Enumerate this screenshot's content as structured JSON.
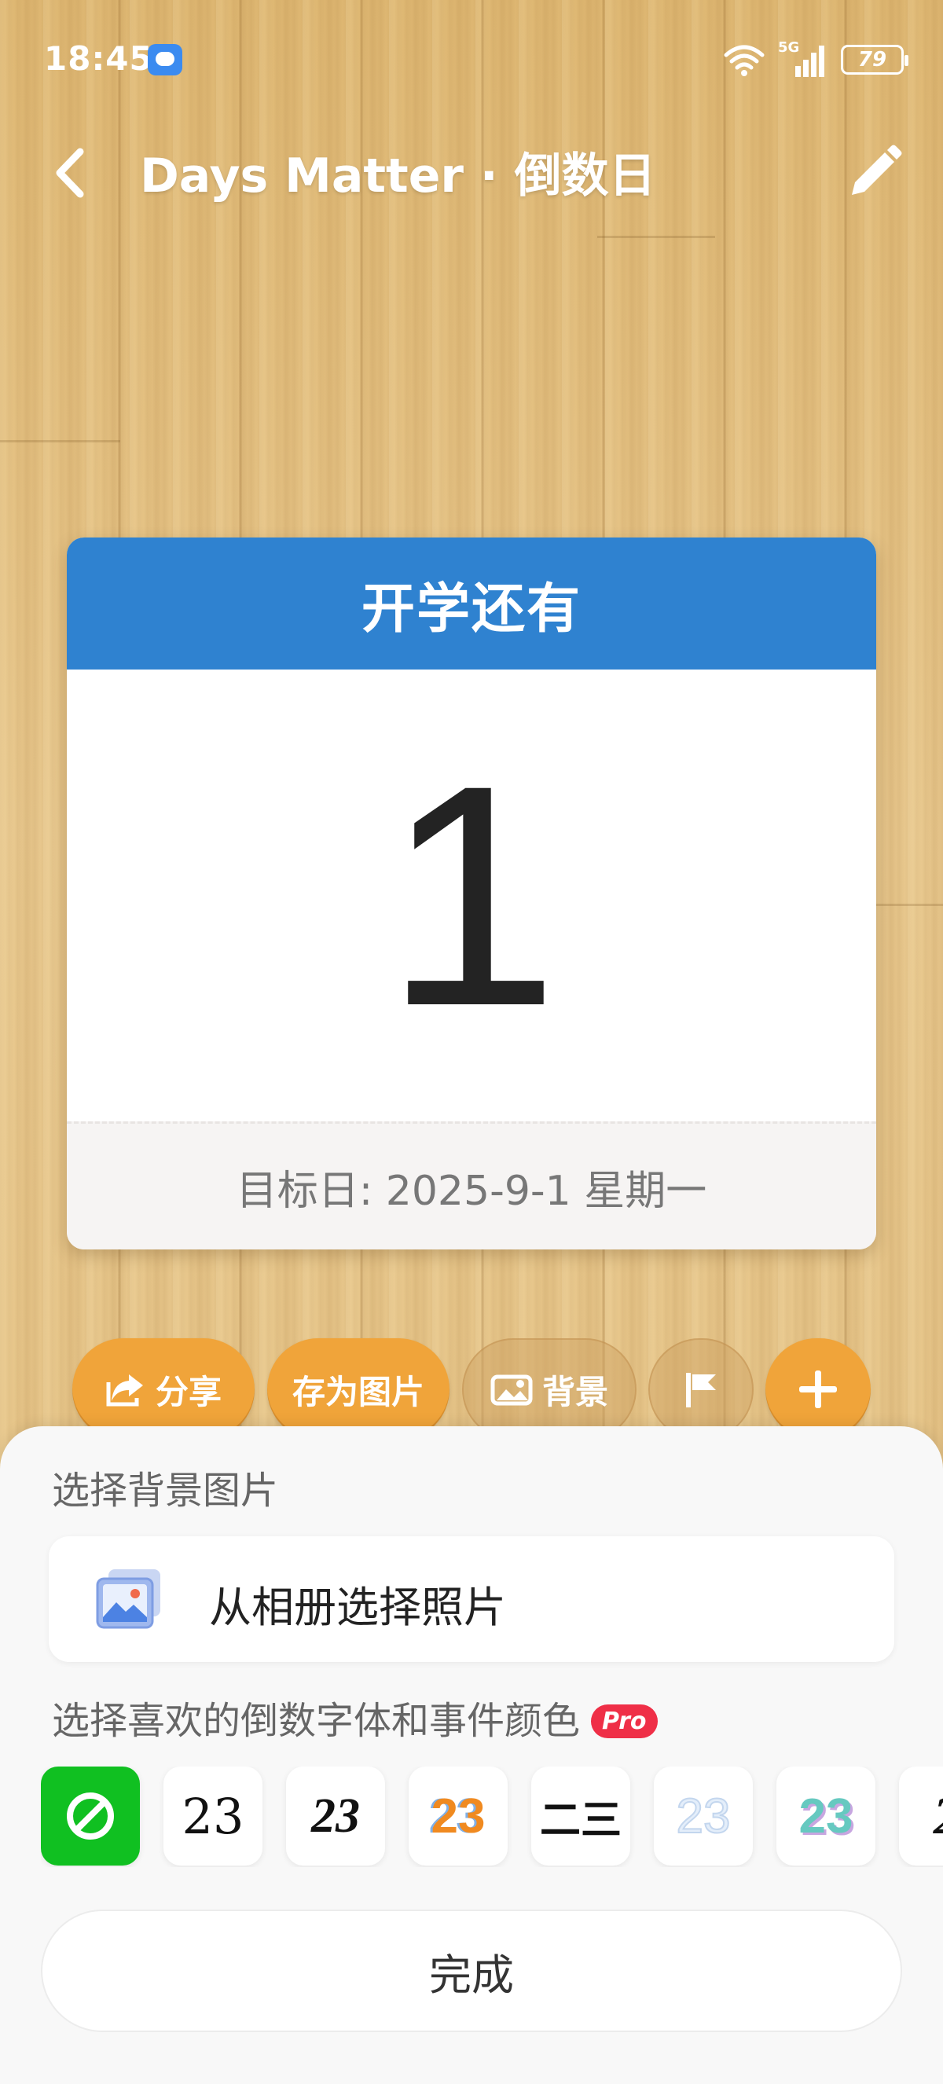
{
  "status_bar": {
    "time": "18:45",
    "network": "5G",
    "battery": "79"
  },
  "app_bar": {
    "title": "Days Matter · 倒数日",
    "back_icon": "chevron-left-icon",
    "edit_icon": "pencil-icon"
  },
  "card": {
    "header": "开学还有",
    "days": "1",
    "target": "目标日: 2025-9-1 星期一",
    "header_color": "#2f82d0"
  },
  "actions": [
    {
      "label": "分享",
      "icon": "share-icon"
    },
    {
      "label": "存为图片",
      "icon": ""
    },
    {
      "label": "背景",
      "icon": "image-icon"
    },
    {
      "label": "",
      "icon": "flag-icon"
    },
    {
      "label": "",
      "icon": "plus-icon"
    }
  ],
  "sheet": {
    "bg_label": "选择背景图片",
    "album_label": "从相册选择照片",
    "font_label": "选择喜欢的倒数字体和事件颜色",
    "pro_badge": "Pro",
    "font_samples": [
      "23",
      "23",
      "23",
      "二三",
      "23",
      "23",
      "2"
    ],
    "done_label": "完成"
  }
}
